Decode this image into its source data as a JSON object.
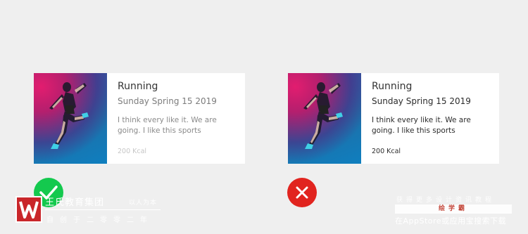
{
  "cards": [
    {
      "title": "Running",
      "date": "Sunday Spring 15 2019",
      "description": "I think every like it. We are going. I like this sports",
      "kcal": "200 Kcal"
    },
    {
      "title": "Running",
      "date": "Sunday Spring 15 2019",
      "description": "I think every like it. We are going. I like this sports",
      "kcal": "200 Kcal"
    }
  ],
  "status": {
    "correct_icon": "check-icon",
    "correct_color": "#14c94e",
    "wrong_icon": "close-icon",
    "wrong_color": "#e1241f"
  },
  "watermark": {
    "brand_name": "王氏教育集团",
    "motto": "以人为本",
    "slogan": "自创于二零零二年",
    "right_top": "获得更多设计资讯教程",
    "right_box": "绘学霸",
    "right_bottom": "在AppStore或应用宝搜索下载",
    "logo_color": "#c9262a"
  }
}
